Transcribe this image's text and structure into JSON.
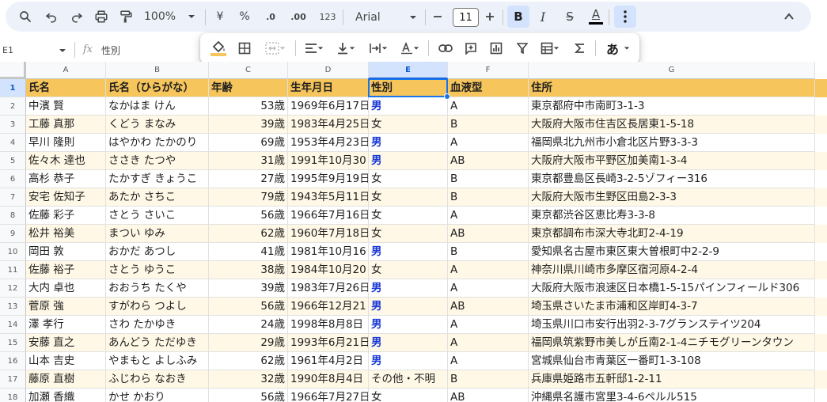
{
  "toolbar": {
    "zoom": "100%",
    "currency": "¥",
    "percent": "%",
    "decrease_decimals": ".0",
    "increase_decimals": ".00",
    "number_format": "123",
    "font_name": "Arial",
    "font_size": "11",
    "bold": "B",
    "italic": "I",
    "strike": "S",
    "text_color": "A"
  },
  "formula_bar": {
    "name_box": "E1",
    "fx": "fx",
    "content": "性別"
  },
  "floating_toolbar": {
    "ime_label": "あ"
  },
  "colors": {
    "header_fill": "#f6c55b",
    "band_fill": "#fff8e6",
    "male_text": "#1a38d6",
    "selection": "#1a73e8"
  },
  "grid": {
    "column_letters": [
      "A",
      "B",
      "C",
      "D",
      "E",
      "F",
      "G"
    ],
    "selected_column": "E",
    "selected_row": "1",
    "row_numbers": [
      "1",
      "2",
      "3",
      "4",
      "5",
      "6",
      "7",
      "8",
      "9",
      "10",
      "11",
      "12",
      "13",
      "14",
      "15",
      "16",
      "17",
      "18"
    ],
    "rows": [
      [
        "氏名",
        "氏名（ひらがな）",
        "年齢",
        "生年月日",
        "性別",
        "血液型",
        "住所"
      ],
      [
        "中濱 賢",
        "なかはま けん",
        "53歳",
        "1969年6月17日",
        "男",
        "A",
        "東京都府中市南町3-1-3"
      ],
      [
        "工藤 真那",
        "くどう まなみ",
        "39歳",
        "1983年4月25日",
        "女",
        "B",
        "大阪府大阪市住吉区長居東1-5-18"
      ],
      [
        "早川 隆則",
        "はやかわ たかのり",
        "69歳",
        "1953年4月23日",
        "男",
        "A",
        "福岡県北九州市小倉北区片野3-3-3"
      ],
      [
        "佐々木 達也",
        "ささき たつや",
        "31歳",
        "1991年10月30日",
        "男",
        "AB",
        "大阪府大阪市平野区加美南1-3-4"
      ],
      [
        "高杉 恭子",
        "たかすぎ きょうこ",
        "27歳",
        "1995年9月19日",
        "女",
        "B",
        "東京都豊島区長崎3-2-5ゾフィー316"
      ],
      [
        "安宅 佐知子",
        "あたか さちこ",
        "79歳",
        "1943年5月11日",
        "女",
        "B",
        "大阪府大阪市生野区田島2-3-3"
      ],
      [
        "佐藤 彩子",
        "さとう さいこ",
        "56歳",
        "1966年7月16日",
        "女",
        "A",
        "東京都渋谷区恵比寿3-3-8"
      ],
      [
        "松井 裕美",
        "まつい ゆみ",
        "62歳",
        "1960年7月18日",
        "女",
        "AB",
        "東京都調布市深大寺北町2-4-19"
      ],
      [
        "岡田 敦",
        "おかだ あつし",
        "41歳",
        "1981年10月16日",
        "男",
        "B",
        "愛知県名古屋市東区東大曽根町中2-2-9"
      ],
      [
        "佐藤 裕子",
        "さとう ゆうこ",
        "38歳",
        "1984年10月20日",
        "女",
        "A",
        "神奈川県川崎市多摩区宿河原4-2-4"
      ],
      [
        "大内 卓也",
        "おおうち たくや",
        "39歳",
        "1983年7月26日",
        "男",
        "A",
        "大阪府大阪市浪速区日本橋1-5-15パインフィールド306"
      ],
      [
        "菅原 強",
        "すがわら つよし",
        "56歳",
        "1966年12月21日",
        "男",
        "AB",
        "埼玉県さいたま市浦和区岸町4-3-7"
      ],
      [
        "澤 孝行",
        "さわ たかゆき",
        "24歳",
        "1998年8月8日",
        "男",
        "A",
        "埼玉県川口市安行出羽2-3-7グランステイツ204"
      ],
      [
        "安藤 直之",
        "あんどう ただゆき",
        "29歳",
        "1993年6月21日",
        "男",
        "A",
        "福岡県筑紫野市美しが丘南2-1-4ニチモグリーンタウン"
      ],
      [
        "山本 吉史",
        "やまもと よしふみ",
        "62歳",
        "1961年4月2日",
        "男",
        "A",
        "宮城県仙台市青葉区一番町1-3-108"
      ],
      [
        "藤原 直樹",
        "ふじわら なおき",
        "32歳",
        "1990年8月4日",
        "その他・不明",
        "B",
        "兵庫県姫路市五軒邸1-2-11"
      ],
      [
        "加瀬 香織",
        "かせ かおり",
        "56歳",
        "1966年7月27日",
        "女",
        "AB",
        "沖縄県名護市宮里3-4-6ペルル515"
      ]
    ]
  }
}
